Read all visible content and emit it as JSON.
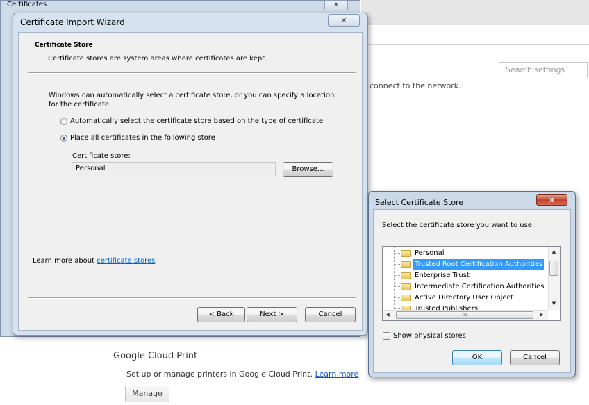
{
  "background_page": {
    "search_placeholder": "Search settings",
    "network_text": "connect to the network.",
    "cloud_print": {
      "title": "Google Cloud Print",
      "description": "Set up or manage printers in Google Cloud Print.",
      "learn_more": "Learn more",
      "manage_button": "Manage"
    }
  },
  "certificates_window": {
    "title": "Certificates",
    "close_glyph": "✕"
  },
  "wizard": {
    "title": "Certificate Import Wizard",
    "close_glyph": "✕",
    "header_title": "Certificate Store",
    "header_subtitle": "Certificate stores are system areas where certificates are kept.",
    "description": "Windows can automatically select a certificate store, or you can specify a location for the certificate.",
    "option_auto": "Automatically select the certificate store based on the type of certificate",
    "option_place": "Place all certificates in the following store",
    "selected_option": "place",
    "store_label": "Certificate store:",
    "store_value": "Personal",
    "browse_button": "Browse...",
    "learn_more_prefix": "Learn more about ",
    "learn_more_link": "certificate stores",
    "back_button": "< Back",
    "next_button": "Next >",
    "cancel_button": "Cancel"
  },
  "select_store": {
    "title": "Select Certificate Store",
    "close_glyph": "x",
    "prompt": "Select the certificate store you want to use.",
    "stores": [
      "Personal",
      "Trusted Root Certification Authorities",
      "Enterprise Trust",
      "Intermediate Certification Authorities",
      "Active Directory User Object",
      "Trusted Publishers"
    ],
    "selected_store": "Trusted Root Certification Authorities",
    "hscroll_thumb": "III",
    "show_physical": "Show physical stores",
    "show_physical_checked": false,
    "ok_button": "OK",
    "cancel_button": "Cancel"
  }
}
